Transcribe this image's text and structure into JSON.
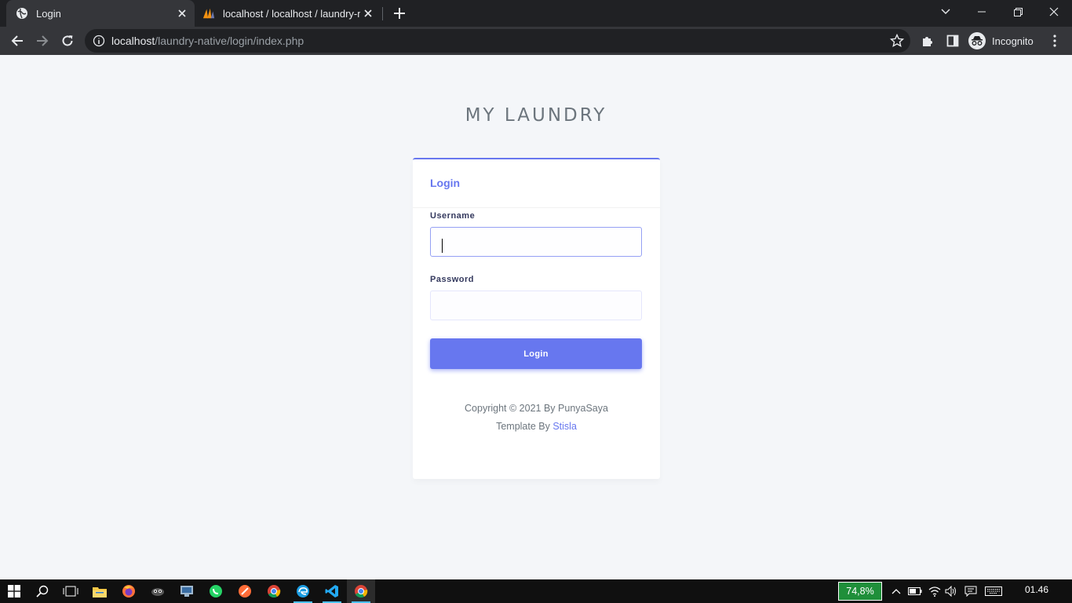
{
  "browser": {
    "tabs": [
      {
        "title": "Login",
        "favicon": "globe-icon",
        "active": true
      },
      {
        "title": "localhost / localhost / laundry-na",
        "favicon": "phpmyadmin-icon",
        "active": false
      }
    ],
    "url_host": "localhost",
    "url_path": "/laundry-native/login/index.php",
    "profile_label": "Incognito"
  },
  "page": {
    "brand": "MY LAUNDRY",
    "card_title": "Login",
    "username_label": "Username",
    "username_value": "",
    "password_label": "Password",
    "password_value": "",
    "login_button": "Login",
    "copyright": "Copyright © 2021 By PunyaSaya",
    "template_prefix": "Template By ",
    "template_link": "Stisla",
    "accent_color": "#6777ef"
  },
  "taskbar": {
    "apps": [
      "windows-start-icon",
      "search-icon",
      "task-view-icon",
      "file-explorer-icon",
      "firefox-icon",
      "app-icon",
      "network-app-icon",
      "whatsapp-icon",
      "postman-icon",
      "chrome-icon",
      "edge-icon",
      "vscode-icon",
      "chrome-incognito-icon"
    ],
    "battery": "74,8%",
    "time": "01.46"
  }
}
